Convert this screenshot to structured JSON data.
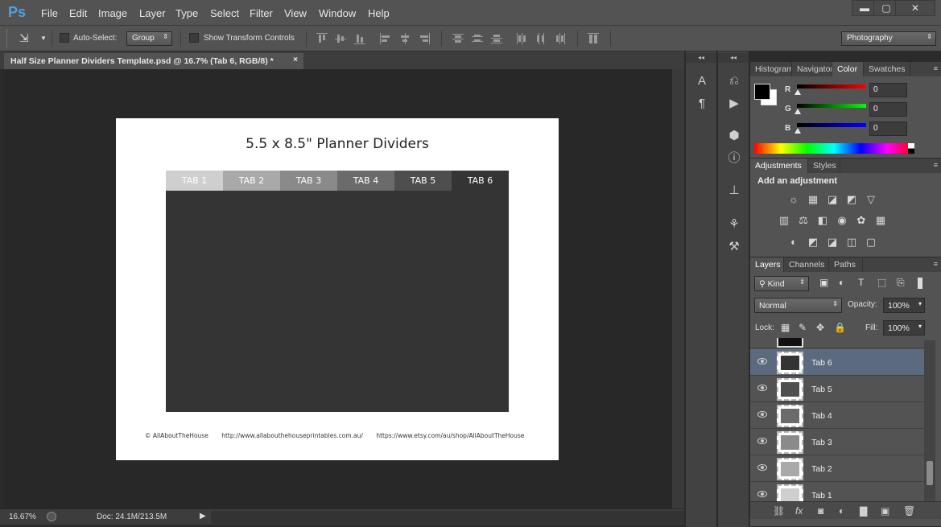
{
  "app": {
    "logo": "Ps"
  },
  "menu": [
    "File",
    "Edit",
    "Image",
    "Layer",
    "Type",
    "Select",
    "Filter",
    "View",
    "Window",
    "Help"
  ],
  "window_controls": {
    "minimize": "▬",
    "maximize": "▢",
    "close": "✕"
  },
  "options_bar": {
    "auto_select_label": "Auto-Select:",
    "auto_select_value": "Group",
    "show_transform_label": "Show Transform Controls",
    "workspace": "Photography"
  },
  "document_tab": {
    "title": "Half Size Planner Dividers Template.psd @ 16.7% (Tab 6, RGB/8) *",
    "close": "×"
  },
  "canvas": {
    "heading": "5.5 x 8.5\" Planner Dividers",
    "tabs": [
      {
        "label": "TAB 1",
        "bg": "#cfcfcf",
        "fg": "#ffffff"
      },
      {
        "label": "TAB 2",
        "bg": "#a9a9a9",
        "fg": "#ffffff"
      },
      {
        "label": "TAB 3",
        "bg": "#8a8a8a",
        "fg": "#ffffff"
      },
      {
        "label": "TAB 4",
        "bg": "#6b6b6b",
        "fg": "#ffffff"
      },
      {
        "label": "TAB 5",
        "bg": "#4e4e4e",
        "fg": "#ffffff"
      },
      {
        "label": "TAB 6",
        "bg": "#343434",
        "fg": "#ffffff"
      }
    ],
    "footer": [
      "© AllAboutTheHouse",
      "http://www.allabouthehouseprintables.com.au/",
      "https://www.etsy.com/au/shop/AllAboutTheHouse"
    ]
  },
  "status": {
    "zoom": "16.67%",
    "doc_size": "Doc: 24.1M/213.5M",
    "arrow": "▶"
  },
  "color_panel": {
    "tabs": [
      "Histogram",
      "Navigator",
      "Color",
      "Swatches"
    ],
    "active_tab": "Color",
    "channels": [
      {
        "label": "R",
        "value": "0",
        "color": "#ff0000"
      },
      {
        "label": "G",
        "value": "0",
        "color": "#00ff00"
      },
      {
        "label": "B",
        "value": "0",
        "color": "#0000ff"
      }
    ]
  },
  "adjustments_panel": {
    "tabs": [
      "Adjustments",
      "Styles"
    ],
    "active_tab": "Adjustments",
    "title": "Add an adjustment",
    "icons_row1": [
      "☼",
      "▦",
      "◪",
      "◩",
      "▽"
    ],
    "icons_row2": [
      "▥",
      "⚖",
      "◧",
      "◉",
      "✿",
      "▦"
    ],
    "icons_row3": [
      "◐",
      "◩",
      "◪",
      "◫",
      "▢"
    ]
  },
  "layers_panel": {
    "tabs": [
      "Layers",
      "Channels",
      "Paths"
    ],
    "active_tab": "Layers",
    "filter_kind": "Kind",
    "blend_mode": "Normal",
    "opacity_label": "Opacity:",
    "opacity_value": "100%",
    "lock_label": "Lock:",
    "fill_label": "Fill:",
    "fill_value": "100%",
    "layers": [
      {
        "name": "Tab 6",
        "selected": true,
        "swatch": "#343434"
      },
      {
        "name": "Tab 5",
        "selected": false,
        "swatch": "#4e4e4e"
      },
      {
        "name": "Tab 4",
        "selected": false,
        "swatch": "#6b6b6b"
      },
      {
        "name": "Tab 3",
        "selected": false,
        "swatch": "#8a8a8a"
      },
      {
        "name": "Tab 2",
        "selected": false,
        "swatch": "#a9a9a9"
      },
      {
        "name": "Tab 1",
        "selected": false,
        "swatch": "#cfcfcf"
      }
    ],
    "footer_icons": [
      "⛓",
      "fx",
      "◙",
      "◐",
      "▇",
      "▣",
      "🗑"
    ]
  }
}
